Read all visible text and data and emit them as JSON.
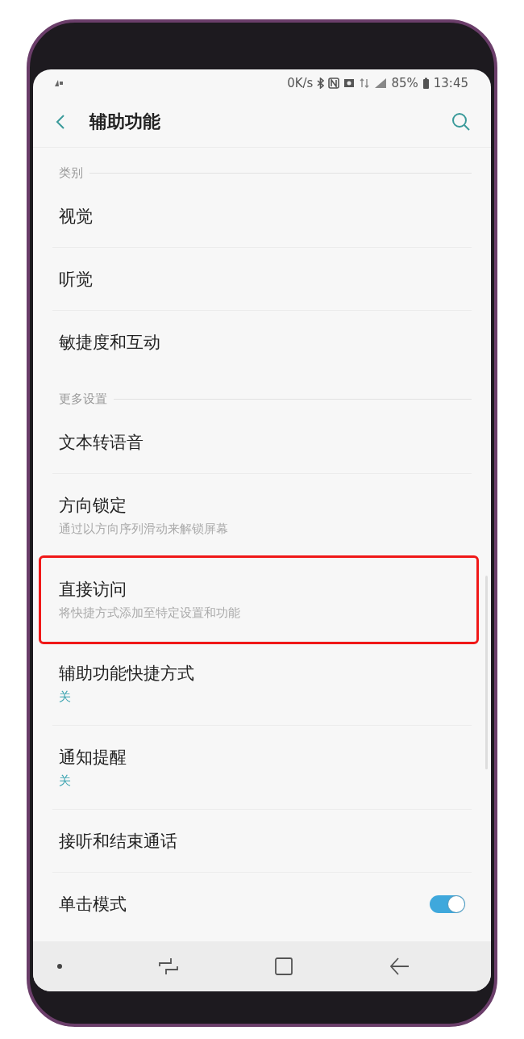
{
  "status_bar": {
    "speed": "0K/s",
    "battery": "85%",
    "time": "13:45"
  },
  "header": {
    "title": "辅助功能"
  },
  "sections": [
    {
      "header": "类别",
      "items": [
        {
          "kind": "plain",
          "title": "视觉",
          "highlighted": false
        },
        {
          "kind": "plain",
          "title": "听觉",
          "highlighted": false
        },
        {
          "kind": "plain",
          "title": "敏捷度和互动",
          "highlighted": false
        }
      ]
    },
    {
      "header": "更多设置",
      "items": [
        {
          "kind": "plain",
          "title": "文本转语音",
          "highlighted": false
        },
        {
          "kind": "plain",
          "title": "方向锁定",
          "subtitle": "通过以方向序列滑动来解锁屏幕",
          "highlighted": false
        },
        {
          "kind": "plain",
          "title": "直接访问",
          "subtitle": "将快捷方式添加至特定设置和功能",
          "highlighted": true
        },
        {
          "kind": "plain",
          "title": "辅助功能快捷方式",
          "value": "关",
          "highlighted": false
        },
        {
          "kind": "plain",
          "title": "通知提醒",
          "value": "关",
          "highlighted": false
        },
        {
          "kind": "plain",
          "title": "接听和结束通话",
          "highlighted": false
        },
        {
          "kind": "toggle",
          "title": "单击模式",
          "on": true,
          "highlighted": false
        }
      ]
    }
  ]
}
